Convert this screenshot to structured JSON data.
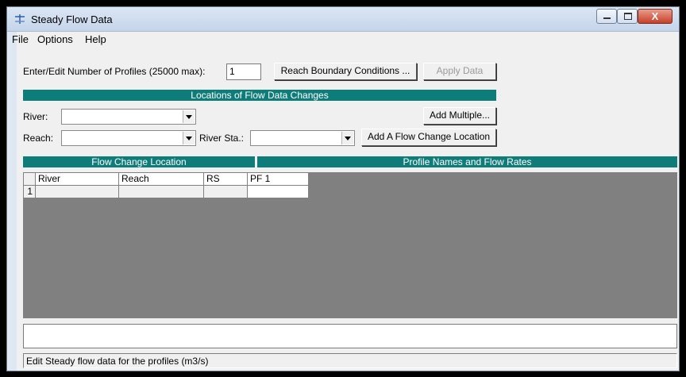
{
  "window": {
    "title": "Steady Flow Data",
    "close_glyph": "X"
  },
  "menu": {
    "file": "File",
    "options": "Options",
    "help": "Help"
  },
  "profiles": {
    "label": "Enter/Edit Number of Profiles (25000 max):",
    "value": "1",
    "reach_boundary_button": "Reach Boundary Conditions ...",
    "apply_button": "Apply Data"
  },
  "locations": {
    "header": "Locations of Flow Data Changes",
    "river_label": "River:",
    "river_value": "",
    "reach_label": "Reach:",
    "reach_value": "",
    "river_sta_label": "River Sta.:",
    "river_sta_value": "",
    "add_multiple_button": "Add Multiple...",
    "add_location_button": "Add A Flow Change Location"
  },
  "table": {
    "flow_change_header": "Flow Change Location",
    "profile_header": "Profile Names and Flow Rates",
    "columns": [
      "River",
      "Reach",
      "RS",
      "PF 1"
    ],
    "rows": [
      {
        "num": "1",
        "river": "",
        "reach": "",
        "rs": "",
        "pf1": ""
      }
    ]
  },
  "status": {
    "text": "Edit Steady flow data for the profiles (m3/s)"
  },
  "icons": {
    "app": "steady-flow-app-icon",
    "dropdown": "chevron-down-icon"
  }
}
